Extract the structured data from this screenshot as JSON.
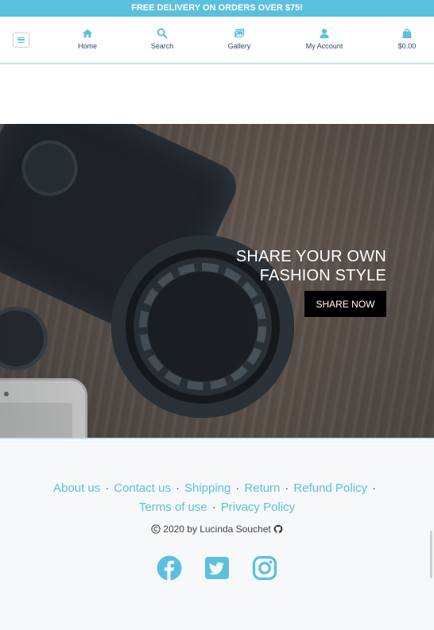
{
  "promo": {
    "text": "FREE DELIVERY ON ORDERS OVER $75!"
  },
  "nav": {
    "menu_icon": "hamburger-icon",
    "items": [
      {
        "label": "Home",
        "icon": "home-icon"
      },
      {
        "label": "Search",
        "icon": "search-icon"
      },
      {
        "label": "Gallery",
        "icon": "images-icon"
      },
      {
        "label": "My Account",
        "icon": "user-icon"
      },
      {
        "label": "$0.00",
        "icon": "shopping-bag-icon"
      }
    ]
  },
  "hero": {
    "title_line1": "SHARE YOUR OWN",
    "title_line2": "FASHION STYLE",
    "button_label": "SHARE NOW"
  },
  "footer": {
    "links": [
      "About us",
      "Contact us",
      "Shipping",
      "Return",
      "Refund Policy",
      "Terms of use",
      "Privacy Policy"
    ],
    "separator": "·",
    "copyright": "2020 by Lucinda Souchet",
    "social": [
      "facebook-icon",
      "twitter-icon",
      "instagram-icon"
    ]
  },
  "colors": {
    "accent": "#5bc0de",
    "nav_text": "#2b4a66",
    "footer_bg": "#f7f8f9",
    "button_bg": "#000000"
  }
}
